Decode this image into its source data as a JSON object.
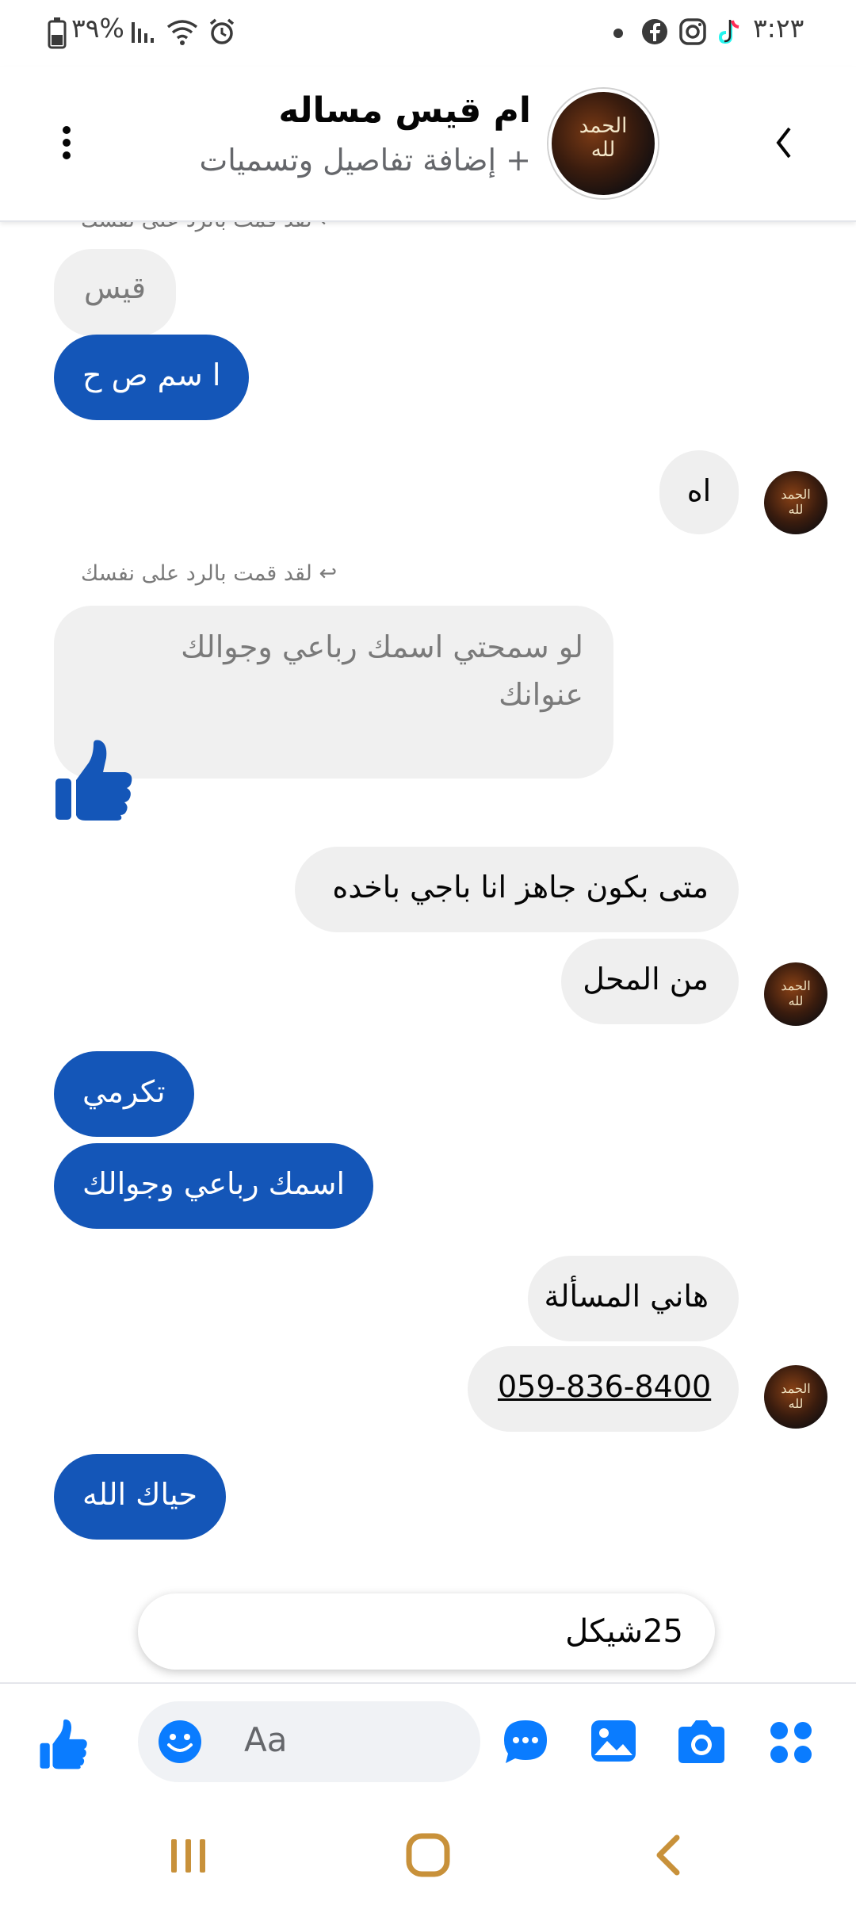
{
  "status_bar": {
    "time": "٣:٢٣",
    "battery": "%٣٩"
  },
  "header": {
    "name": "ام قيس مساله",
    "subtitle": "+ إضافة تفاصيل وتسميات",
    "avatar_text": "الحمد لله"
  },
  "messages": {
    "reply_note_top": "لقد قمت بالرد على نفسك",
    "quoted_1": "قيس",
    "me_1": "ا سم ص ح",
    "them_1": "اه",
    "reply_note_2": "لقد قمت بالرد على نفسك",
    "quoted_2_line1": "لو سمحتي اسمك رباعي وجوالك",
    "quoted_2_line2": "عنوانك",
    "them_2": "متى بكون جاهز انا باجي باخده",
    "them_3": "من المحل",
    "me_2": "تكرمي",
    "me_3": "اسمك رباعي وجوالك",
    "them_4": "هاني المسألة",
    "them_5": "059-836-8400",
    "me_4": "حياك الله"
  },
  "composer": {
    "draft_text": "25شيكل",
    "placeholder": "Aa"
  },
  "colors": {
    "accent": "#1456b8",
    "messenger_blue": "#0a7cff"
  }
}
